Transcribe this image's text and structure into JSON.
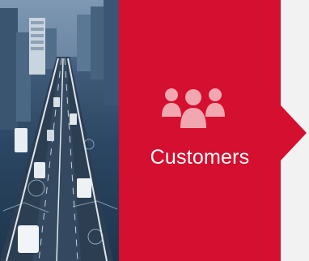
{
  "card": {
    "title": "Customers",
    "icon": "group-of-people-icon",
    "background_color": "#d50f2f",
    "icon_color": "#f1a7b0",
    "text_color": "#ffffff"
  }
}
